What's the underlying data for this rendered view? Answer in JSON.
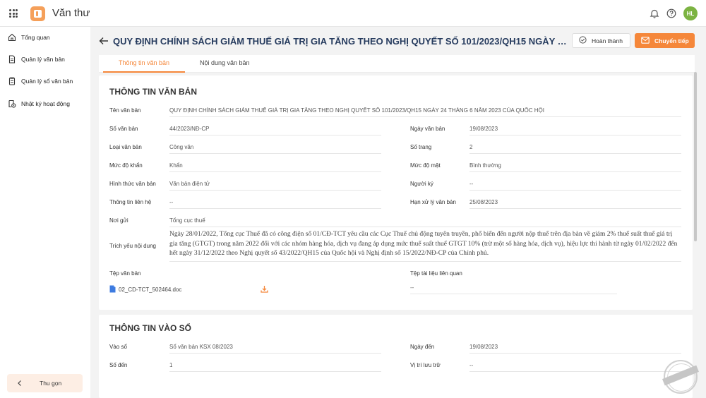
{
  "app": {
    "title": "Văn thư",
    "user_initials": "HL"
  },
  "topbar": {
    "icons": [
      "apps-grid-icon",
      "bell-icon",
      "help-icon"
    ]
  },
  "sidebar": {
    "items": [
      {
        "label": "Tổng quan",
        "icon": "home-icon"
      },
      {
        "label": "Quản lý văn bản",
        "icon": "document-icon"
      },
      {
        "label": "Quản lý sổ văn bản",
        "icon": "register-book-icon"
      },
      {
        "label": "Nhật ký hoạt động",
        "icon": "activity-log-icon"
      }
    ],
    "collapse_label": "Thu gọn"
  },
  "header": {
    "title": "QUY ĐỊNH CHÍNH SÁCH GIẢM THUẾ GIÁ TRỊ GIA TĂNG THEO NGHỊ QUYẾT SỐ 101/2023/QH15 NGÀY 24 THÁNG 6 NĂM 2023 CỦA QUỐC HỘI",
    "done_label": "Hoàn thành",
    "forward_label": "Chuyển tiếp"
  },
  "tabs": [
    {
      "label": "Thông tin văn bản",
      "active": true
    },
    {
      "label": "Nội dung văn bản",
      "active": false
    }
  ],
  "doc_info": {
    "section_title": "THÔNG TIN VĂN BẢN",
    "ten_van_ban": {
      "label": "Tên văn bản",
      "value": "QUY ĐỊNH CHÍNH SÁCH GIẢM THUẾ GIÁ TRỊ GIA TĂNG THEO NGHỊ QUYẾT SỐ 101/2023/QH15 NGÀY 24 THÁNG 6 NĂM 2023 CỦA QUỐC HỘI"
    },
    "so_van_ban": {
      "label": "Số văn bản",
      "value": "44/2023/NĐ-CP"
    },
    "ngay_van_ban": {
      "label": "Ngày văn bản",
      "value": "19/08/2023"
    },
    "loai_van_ban": {
      "label": "Loại văn bản",
      "value": "Công văn"
    },
    "so_trang": {
      "label": "Số trang",
      "value": "2"
    },
    "muc_do_khan": {
      "label": "Mức độ khẩn",
      "value": "Khẩn"
    },
    "muc_do_mat": {
      "label": "Mức độ mật",
      "value": "Bình thường"
    },
    "hinh_thuc": {
      "label": "Hình thức văn bản",
      "value": "Văn bản điện tử"
    },
    "nguoi_ky": {
      "label": "Người ký",
      "value": "--"
    },
    "thong_tin_lien_he": {
      "label": "Thông tin liên hệ",
      "value": "--"
    },
    "han_xu_ly": {
      "label": "Hạn xử lý văn bản",
      "value": "25/08/2023"
    },
    "noi_gui": {
      "label": "Nơi gửi",
      "value": "Tổng cục thuế"
    },
    "trich_yeu": {
      "label": "Trích yếu nội dung",
      "value": "Ngày 28/01/2022, Tổng cục Thuế đã có công điện số 01/CĐ-TCT yêu cầu các Cục Thuế chủ động tuyên truyền, phổ biến đến người nộp thuế trên địa bàn về giảm 2% thuế suất thuế giá trị gia tăng (GTGT) trong năm 2022 đối với các nhóm hàng hóa, dịch vụ đang áp dụng mức thuế suất thuế GTGT 10% (trừ một số hàng hóa, dịch vụ), hiệu lực thi hành từ ngày 01/02/2022 đến hết ngày 31/12/2022 theo Nghị quyết số 43/2022/QH15 của Quốc hội và Nghị định số 15/2022/NĐ-CP của Chính phủ."
    },
    "tep_van_ban": {
      "label": "Tệp văn bản",
      "file_name": "02_CD-TCT_502464.doc"
    },
    "tep_lien_quan": {
      "label": "Tệp tài liệu liên quan",
      "value": "--"
    }
  },
  "entry_info": {
    "section_title": "THÔNG TIN VÀO SỔ",
    "vao_so": {
      "label": "Vào sổ",
      "value": "Sổ văn bản KSX 08/2023"
    },
    "ngay_den": {
      "label": "Ngày đến",
      "value": "19/08/2023"
    },
    "so_den": {
      "label": "Số đến",
      "value": "1"
    },
    "vi_tri_luu_tru": {
      "label": "Vị trí lưu trữ",
      "value": "--"
    }
  },
  "colors": {
    "accent": "#f5873a",
    "title_navy": "#263b5e",
    "avatar": "#7cb342"
  }
}
